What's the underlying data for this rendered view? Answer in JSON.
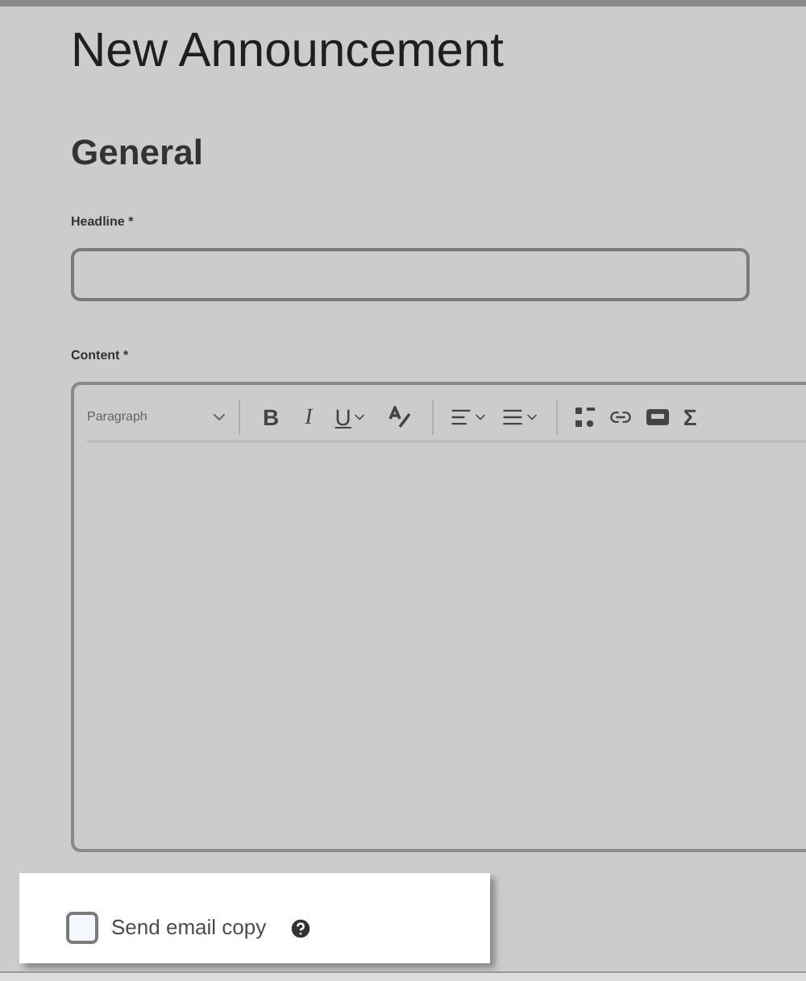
{
  "page": {
    "title": "New Announcement"
  },
  "section": {
    "title": "General"
  },
  "headline_field": {
    "label": "Headline",
    "required_mark": "*"
  },
  "content_field": {
    "label": "Content",
    "required_mark": "*",
    "toolbar": {
      "format_select": "Paragraph",
      "bold": "B",
      "italic": "I",
      "underline": "U",
      "sigma": "Σ"
    }
  },
  "email_copy": {
    "label": "Send email copy",
    "checked": false
  }
}
